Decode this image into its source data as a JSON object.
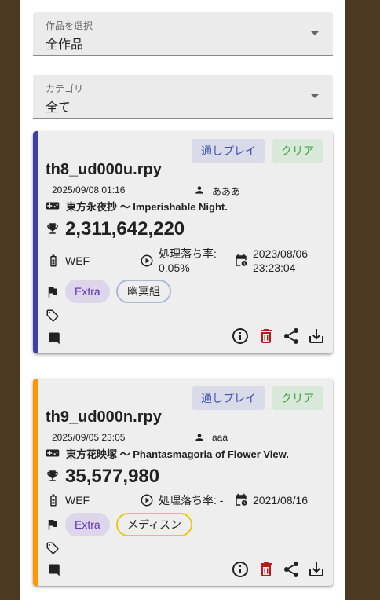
{
  "filters": [
    {
      "label": "作品を選択",
      "value": "全作品"
    },
    {
      "label": "カテゴリ",
      "value": "全て"
    }
  ],
  "cards": [
    {
      "accent": "#3f3fa8",
      "chips": {
        "run": "通しプレイ",
        "clear": "クリア"
      },
      "filename": "th8_ud000u.rpy",
      "date": "2025/09/08 01:16",
      "user": "あああ",
      "game": "東方永夜抄 〜 Imperishable Night.",
      "score": "2,311,642,220",
      "shot": "WEF",
      "slowdown": "処理落ち率: 0.05%",
      "play_date": "2023/08/06 23:23:04",
      "difficulty": "Extra",
      "route": "幽冥組",
      "route_color": "#a9b8d4"
    },
    {
      "accent": "#ff9800",
      "chips": {
        "run": "通しプレイ",
        "clear": "クリア"
      },
      "filename": "th9_ud000n.rpy",
      "date": "2025/09/05 23:05",
      "user": "aaa",
      "game": "東方花映塚 〜 Phantasmagoria of Flower View.",
      "score": "35,577,980",
      "shot": "WEF",
      "slowdown": "処理落ち率: -",
      "play_date": "2021/08/16",
      "difficulty": "Extra",
      "route": "メディスン",
      "route_color": "#e8c81a"
    }
  ],
  "icons": {
    "user": "person-icon",
    "game": "gamepad-icon",
    "score": "trophy-icon",
    "shot": "battery-icon",
    "slowdown": "play-circle-icon",
    "date": "calendar-clock-icon",
    "difficulty": "flag-icon",
    "tags": "tag-icon",
    "comment": "comment-icon",
    "actions": [
      "info-icon",
      "delete-icon",
      "share-icon",
      "download-icon"
    ]
  },
  "colors": {
    "delete": "#b71c1c"
  }
}
